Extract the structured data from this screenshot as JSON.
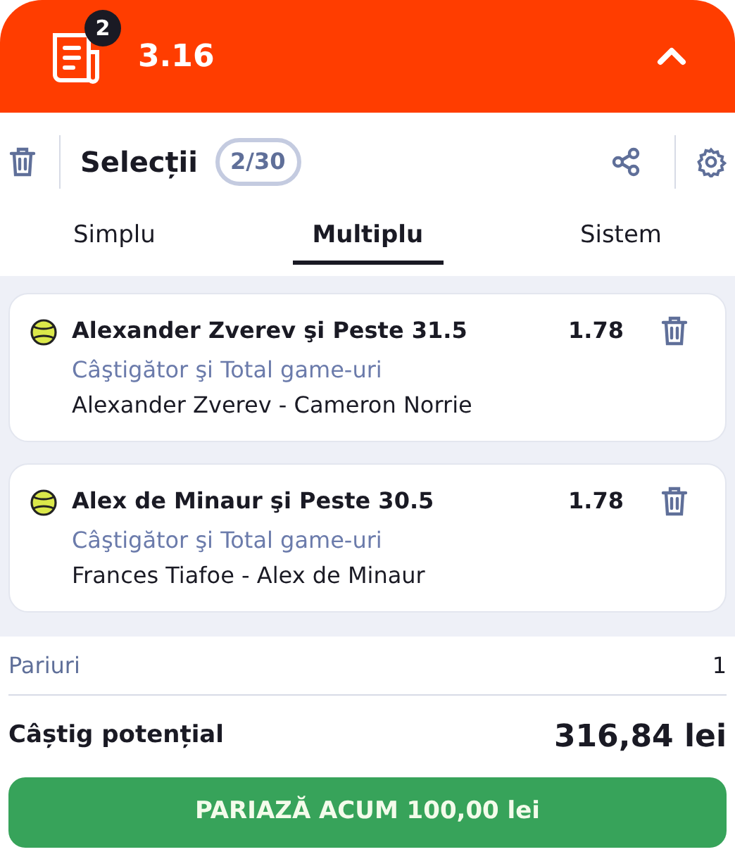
{
  "header": {
    "badge": "2",
    "total_odds": "3.16",
    "expanded": true
  },
  "toolbar": {
    "title": "Selecții",
    "count": "2/30"
  },
  "tabs": [
    {
      "label": "Simplu",
      "selected": false
    },
    {
      "label": "Multiplu",
      "selected": true
    },
    {
      "label": "Sistem",
      "selected": false
    }
  ],
  "selections": [
    {
      "pick": "Alexander Zverev şi Peste 31.5",
      "odds": "1.78",
      "market": "Câştigător şi Total game-uri",
      "event": "Alexander Zverev - Cameron Norrie"
    },
    {
      "pick": "Alex de Minaur şi Peste 30.5",
      "odds": "1.78",
      "market": "Câştigător şi Total game-uri",
      "event": "Frances Tiafoe - Alex de Minaur"
    }
  ],
  "summary": {
    "bets_label": "Pariuri",
    "bets_value": "1",
    "win_label": "Câștig potențial",
    "win_value": "316,84 lei"
  },
  "place_button": "PARIAZĂ ACUM 100,00 lei"
}
